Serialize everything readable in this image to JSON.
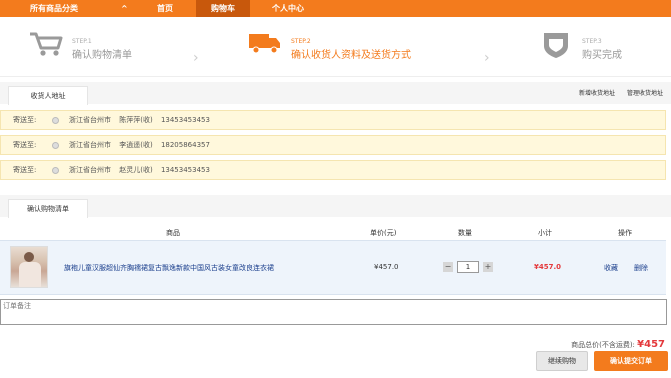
{
  "topnav": {
    "category_label": "所有商品分类",
    "category_chevron": "^",
    "items": [
      "首页",
      "购物车",
      "个人中心"
    ],
    "active_index": 1,
    "accent": "#f37b1d"
  },
  "steps": [
    {
      "num": "STEP.1",
      "label": "确认购物清单",
      "icon": "cart-icon",
      "state": "done"
    },
    {
      "num": "STEP.2",
      "label": "确认收货人资料及送货方式",
      "icon": "truck-icon",
      "state": "current"
    },
    {
      "num": "STEP.3",
      "label": "购买完成",
      "icon": "shield-check-icon",
      "state": "pending"
    }
  ],
  "address_section": {
    "tab_label": "收货人地址",
    "links": [
      "新增收货地址",
      "管理收货地址"
    ],
    "label": "寄送至:",
    "items": [
      {
        "region": "浙江省台州市",
        "name": "陈萍萍(收)",
        "phone": "13453453453"
      },
      {
        "region": "浙江省台州市",
        "name": "李逍遥(收)",
        "phone": "18205864357"
      },
      {
        "region": "浙江省台州市",
        "name": "赵灵儿(收)",
        "phone": "13453453453"
      }
    ]
  },
  "cart_section": {
    "tab_label": "确认购物清单",
    "headers": {
      "product": "商品",
      "unit_price": "单价(元)",
      "quantity": "数量",
      "subtotal": "小计",
      "actions": "操作"
    },
    "items": [
      {
        "name": "旗袍儿童汉服超仙齐胸襦裙复古飘逸新款中国风古装女童改良连衣裙",
        "unit_price": "¥457.0",
        "quantity": "1",
        "qty_minus": "−",
        "qty_plus": "+",
        "subtotal": "¥457.0",
        "actions": [
          "收藏",
          "删除"
        ]
      }
    ]
  },
  "remark": {
    "placeholder": "订单备注"
  },
  "summary": {
    "total_label": "商品总价(不含运费):",
    "currency": "¥",
    "total_value": "457"
  },
  "buttons": {
    "continue": "继续购物",
    "submit": "确认提交订单"
  }
}
